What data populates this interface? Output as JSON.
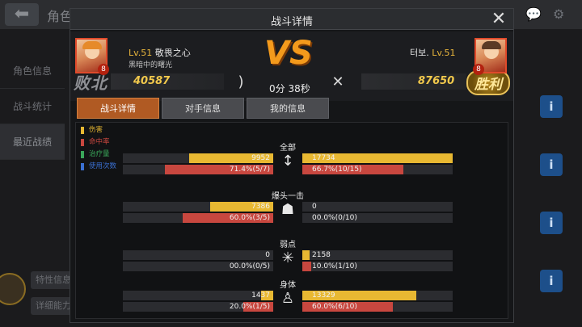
{
  "background": {
    "back_arrow": "⬅",
    "title": "角色",
    "side_items": [
      "角色信息",
      "战斗统计",
      "最近战绩"
    ],
    "info_label": "i",
    "bottom_buttons": [
      "特性信息",
      "详细能力"
    ]
  },
  "dialog": {
    "title": "战斗详情",
    "close": "✕"
  },
  "left_player": {
    "level_prefix": "Lv.51",
    "name": "敬畏之心",
    "subtitle": "黑暗中的曙光",
    "score": "40587",
    "result": "败北",
    "badge": "8"
  },
  "right_player": {
    "name": "터보.",
    "level_prefix": "Lv.51",
    "score": "87650",
    "result": "胜利",
    "badge": "8"
  },
  "match": {
    "vs": "VS",
    "time": "0分 38秒"
  },
  "tabs": [
    "战斗详情",
    "对手信息",
    "我的信息"
  ],
  "legend": [
    {
      "label": "伤害",
      "color": "#e8b832"
    },
    {
      "label": "命中率",
      "color": "#c8473f"
    },
    {
      "label": "治疗量",
      "color": "#3aa65a"
    },
    {
      "label": "使用次数",
      "color": "#3a6fd1"
    }
  ],
  "stats": [
    {
      "category": "全部",
      "icon": "arrow-icon",
      "left": {
        "damage": "9952",
        "damage_frac": 0.56,
        "hit": "71.4%(5/7)",
        "hit_frac": 0.72
      },
      "right": {
        "damage": "17734",
        "damage_frac": 1.0,
        "hit": "66.7%(10/15)",
        "hit_frac": 0.67
      }
    },
    {
      "category": "爆头一击",
      "icon": "helmet-icon",
      "left": {
        "damage": "7386",
        "damage_frac": 0.42,
        "hit": "60.0%(3/5)",
        "hit_frac": 0.6
      },
      "right": {
        "damage": "0",
        "damage_frac": 0.0,
        "hit": "00.0%(0/10)",
        "hit_frac": 0.0
      }
    },
    {
      "category": "弱点",
      "icon": "weakpoint-icon",
      "left": {
        "damage": "0",
        "damage_frac": 0.0,
        "hit": "00.0%(0/5)",
        "hit_frac": 0.0
      },
      "right": {
        "damage": "2158",
        "damage_frac": 0.05,
        "hit": "10.0%(1/10)",
        "hit_frac": 0.06
      }
    },
    {
      "category": "身体",
      "icon": "body-icon",
      "left": {
        "damage": "1437",
        "damage_frac": 0.08,
        "hit": "20.0%(1/5)",
        "hit_frac": 0.2
      },
      "right": {
        "damage": "13329",
        "damage_frac": 0.76,
        "hit": "60.0%(6/10)",
        "hit_frac": 0.6
      }
    }
  ]
}
